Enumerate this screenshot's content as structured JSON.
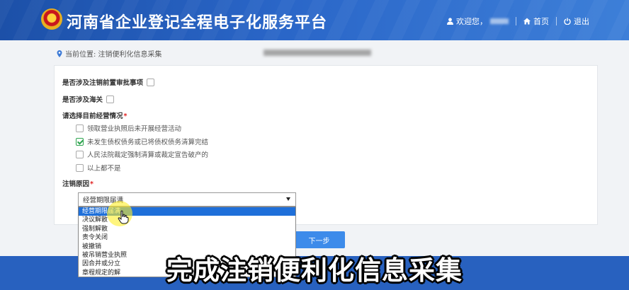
{
  "header": {
    "title": "河南省企业登记全程电子化服务平台",
    "welcome": "欢迎您，",
    "home": "首页",
    "logout": "退出"
  },
  "breadcrumb": {
    "text": "当前位置: 注销便利化信息采集"
  },
  "form": {
    "q_pre_approval": "是否涉及注销前置审批事项",
    "q_customs": "是否涉及海关",
    "q_status": "请选择目前经营情况",
    "required_mark": "*",
    "status_options": [
      {
        "label": "领取营业执照后未开展经营活动",
        "checked": false
      },
      {
        "label": "未发生债权债务或已将债权债务清算完结",
        "checked": true
      },
      {
        "label": "人民法院裁定强制清算或裁定宣告破产的",
        "checked": false
      },
      {
        "label": "以上都不是",
        "checked": false
      }
    ],
    "reason_label": "注销原因",
    "reason_selected": "经营期限届满",
    "reason_options": [
      "经营期限届满",
      "决议解散",
      "强制解散",
      "责令关闭",
      "被撤销",
      "被吊销营业执照",
      "因合并或分立",
      "章程规定的解"
    ],
    "next_button": "下一步"
  },
  "caption": "完成注销便利化信息采集",
  "colors": {
    "header_blue": "#2a66c8",
    "select_blue": "#1e6fd9",
    "button_blue": "#3d8bea",
    "checked_green": "#2ea44f",
    "required_red": "#e02020"
  }
}
